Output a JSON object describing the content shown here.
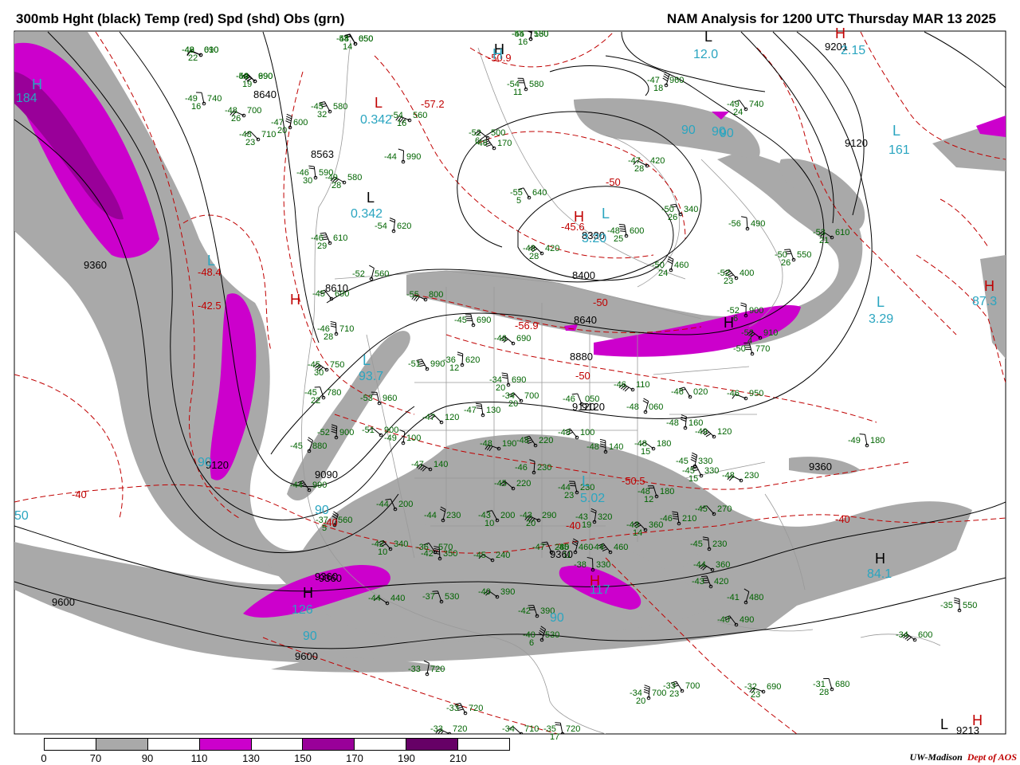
{
  "header": {
    "left_title": "300mb Hght (black) Temp (red) Spd (shd) Obs (grn)",
    "right_title": "NAM Analysis for 1200 UTC Thursday  MAR 13 2025"
  },
  "colors": {
    "height_contour": "#000000",
    "temp_contour": "#c00000",
    "shade_70_90": "#a9a9a9",
    "shade_110_130": "#cc00cc",
    "shade_150_170": "#990099",
    "shade_190_210": "#660066",
    "obs": "#006400",
    "speed_label": "#2aa5c0",
    "borders": "#999999"
  },
  "legend": {
    "ticks": [
      "0",
      "70",
      "90",
      "110",
      "130",
      "150",
      "170",
      "190",
      "210"
    ],
    "segment_colors": [
      "#ffffff",
      "#a9a9a9",
      "#ffffff",
      "#cc00cc",
      "#ffffff",
      "#990099",
      "#ffffff",
      "#660066",
      "#ffffff"
    ]
  },
  "credit": {
    "org": "UW-Madison",
    "dept": "Dept of AOS"
  },
  "height_labels": [
    "9360",
    "8640",
    "8563",
    "8610",
    "9120",
    "9600",
    "9360",
    "9600",
    "9120",
    "9090",
    "8400",
    "8330",
    "8640",
    "8880",
    "9120",
    "9360",
    "9360",
    "9360",
    "9120",
    "9201",
    "9213"
  ],
  "temp_labels": [
    "-48.4",
    "-42.5",
    "-57.2",
    "-50.9",
    "-45.6",
    "-50",
    "-56.9",
    "-50",
    "-50",
    "-50.5",
    "-40",
    "-40",
    "-40",
    "-40"
  ],
  "speed_labels": [
    "184",
    "0.342",
    "0.342",
    "93.7",
    "90",
    "90",
    "126",
    "90",
    "90",
    "12.0",
    "2.15",
    "161",
    "90",
    "3.29",
    "87.3",
    "84.1",
    "5.02",
    "90",
    "117",
    "90",
    "3.20",
    "50"
  ],
  "hl_markers": [
    "H",
    "L",
    "L",
    "L",
    "H",
    "H",
    "L",
    "H",
    "L",
    "L",
    "H",
    "H",
    "L",
    "H",
    "H",
    "L",
    "H",
    "H",
    "L",
    "H",
    "L",
    "H"
  ],
  "obs": [
    {
      "t": "-49",
      "d": "22",
      "h": "690"
    },
    {
      "t": "-54",
      "d": "14",
      "h": "650"
    },
    {
      "t": "-55",
      "d": "16",
      "h": "560"
    },
    {
      "t": "-50",
      "d": "19",
      "h": "690"
    },
    {
      "t": "-49",
      "d": "16",
      "h": "740"
    },
    {
      "t": "-48",
      "d": "26",
      "h": "700"
    },
    {
      "t": "-45",
      "d": "32",
      "h": "580"
    },
    {
      "t": "-47",
      "d": "20",
      "h": "600"
    },
    {
      "t": "-48",
      "d": "23",
      "h": "710"
    },
    {
      "t": "-46",
      "d": "30",
      "h": "590"
    },
    {
      "t": "-49",
      "d": "28",
      "h": "580"
    },
    {
      "t": "-46",
      "d": "29",
      "h": "610"
    },
    {
      "t": "-52",
      "d": "",
      "h": "560"
    },
    {
      "t": "-45",
      "d": "",
      "h": "690"
    },
    {
      "t": "-46",
      "d": "28",
      "h": "710"
    },
    {
      "t": "-45",
      "d": "30",
      "h": "750"
    },
    {
      "t": "-45",
      "d": "22",
      "h": "780"
    },
    {
      "t": "-45",
      "d": "",
      "h": "880"
    },
    {
      "t": "-44",
      "d": "",
      "h": "990"
    },
    {
      "t": "-52",
      "d": "",
      "h": "900"
    },
    {
      "t": "-51",
      "d": "",
      "h": "900"
    },
    {
      "t": "-53",
      "d": "",
      "h": "960"
    },
    {
      "t": "-55",
      "d": "",
      "h": "800"
    },
    {
      "t": "-51",
      "d": "",
      "h": "990"
    },
    {
      "t": "-49",
      "d": "",
      "h": "100"
    },
    {
      "t": "-47",
      "d": "",
      "h": "120"
    },
    {
      "t": "-47",
      "d": "",
      "h": "130"
    },
    {
      "t": "-47",
      "d": "",
      "h": "140"
    },
    {
      "t": "-44",
      "d": "",
      "h": "200"
    },
    {
      "t": "-44",
      "d": "",
      "h": "230"
    },
    {
      "t": "-42",
      "d": "10",
      "h": "340"
    },
    {
      "t": "-42",
      "d": "",
      "h": "350"
    },
    {
      "t": "-44",
      "d": "",
      "h": "440"
    },
    {
      "t": "-37",
      "d": "",
      "h": "530"
    },
    {
      "t": "-37",
      "d": "5",
      "h": "560"
    },
    {
      "t": "-46",
      "d": "",
      "h": "170"
    },
    {
      "t": "-44",
      "d": "",
      "h": "990"
    },
    {
      "t": "-52",
      "d": "6",
      "h": "500"
    },
    {
      "t": "-54",
      "d": "11",
      "h": "580"
    },
    {
      "t": "-54",
      "d": "16",
      "h": "560"
    },
    {
      "t": "-55",
      "d": "5",
      "h": "640"
    },
    {
      "t": "-54",
      "d": "",
      "h": "620"
    },
    {
      "t": "-48",
      "d": "28",
      "h": "420"
    },
    {
      "t": "-48",
      "d": "25",
      "h": "600"
    },
    {
      "t": "-47",
      "d": "28",
      "h": "420"
    },
    {
      "t": "-50",
      "d": "26",
      "h": "340"
    },
    {
      "t": "-50",
      "d": "24",
      "h": "460"
    },
    {
      "t": "-52",
      "d": "23",
      "h": "400"
    },
    {
      "t": "-56",
      "d": "",
      "h": "490"
    },
    {
      "t": "-53",
      "d": "21",
      "h": "610"
    },
    {
      "t": "-50",
      "d": "26",
      "h": "550"
    },
    {
      "t": "-47",
      "d": "18",
      "h": "960"
    },
    {
      "t": "-49",
      "d": "24",
      "h": "740"
    },
    {
      "t": "-52",
      "d": "6",
      "h": "900"
    },
    {
      "t": "-52",
      "d": "4",
      "h": "910"
    },
    {
      "t": "-50",
      "d": "",
      "h": "770"
    },
    {
      "t": "-46",
      "d": "",
      "h": "950"
    },
    {
      "t": "-46",
      "d": "",
      "h": "020"
    },
    {
      "t": "-48",
      "d": "",
      "h": "160"
    },
    {
      "t": "-49",
      "d": "",
      "h": "120"
    },
    {
      "t": "-49",
      "d": "",
      "h": "180"
    },
    {
      "t": "-48",
      "d": "",
      "h": "230"
    },
    {
      "t": "-45",
      "d": "15",
      "h": "330"
    },
    {
      "t": "-45",
      "d": "",
      "h": "330"
    },
    {
      "t": "-45",
      "d": "",
      "h": "270"
    },
    {
      "t": "-45",
      "d": "",
      "h": "230"
    },
    {
      "t": "-44",
      "d": "",
      "h": "360"
    },
    {
      "t": "-43",
      "d": "",
      "h": "420"
    },
    {
      "t": "-41",
      "d": "",
      "h": "480"
    },
    {
      "t": "-40",
      "d": "",
      "h": "490"
    },
    {
      "t": "-35",
      "d": "",
      "h": "550"
    },
    {
      "t": "-34",
      "d": "",
      "h": "600"
    },
    {
      "t": "-31",
      "d": "28",
      "h": "680"
    },
    {
      "t": "-32",
      "d": "23",
      "h": "690"
    },
    {
      "t": "-33",
      "d": "23",
      "h": "700"
    },
    {
      "t": "-34",
      "d": "20",
      "h": "700"
    },
    {
      "t": "-34",
      "d": "",
      "h": "710"
    },
    {
      "t": "-35",
      "d": "17",
      "h": "720"
    },
    {
      "t": "-33",
      "d": "",
      "h": "720"
    },
    {
      "t": "-33",
      "d": "",
      "h": "720"
    },
    {
      "t": "-33",
      "d": "",
      "h": "720"
    },
    {
      "t": "-34",
      "d": "20",
      "h": "700"
    },
    {
      "t": "-34",
      "d": "20",
      "h": "690"
    },
    {
      "t": "-46",
      "d": "",
      "h": "110"
    },
    {
      "t": "-46",
      "d": "",
      "h": "050"
    },
    {
      "t": "-48",
      "d": "",
      "h": "060"
    },
    {
      "t": "-48",
      "d": "",
      "h": "100"
    },
    {
      "t": "-48",
      "d": "",
      "h": "140"
    },
    {
      "t": "-48",
      "d": "15",
      "h": "180"
    },
    {
      "t": "-48",
      "d": "12",
      "h": "180"
    },
    {
      "t": "-48",
      "d": "",
      "h": "190"
    },
    {
      "t": "-48",
      "d": "",
      "h": "220"
    },
    {
      "t": "-46",
      "d": "",
      "h": "230"
    },
    {
      "t": "-45",
      "d": "",
      "h": "220"
    },
    {
      "t": "-44",
      "d": "23",
      "h": "230"
    },
    {
      "t": "-43",
      "d": "20",
      "h": "290"
    },
    {
      "t": "-43",
      "d": "10",
      "h": "200"
    },
    {
      "t": "-43",
      "d": "19",
      "h": "320"
    },
    {
      "t": "-43",
      "d": "14",
      "h": "360"
    },
    {
      "t": "-46",
      "d": "",
      "h": "210"
    },
    {
      "t": "-45",
      "d": "",
      "h": "240"
    },
    {
      "t": "-47",
      "d": "",
      "h": "280"
    },
    {
      "t": "-45",
      "d": "11",
      "h": "460"
    },
    {
      "t": "-44",
      "d": "",
      "h": "460"
    },
    {
      "t": "-38",
      "d": "",
      "h": "330"
    },
    {
      "t": "-40",
      "d": "",
      "h": "390"
    },
    {
      "t": "-42",
      "d": "",
      "h": "390"
    },
    {
      "t": "-40",
      "d": "6",
      "h": "530"
    },
    {
      "t": "-36",
      "d": "",
      "h": "570"
    },
    {
      "t": "-36",
      "d": "12",
      "h": "620"
    },
    {
      "t": "-46",
      "d": "",
      "h": "690"
    },
    {
      "t": "-45",
      "d": "",
      "h": "690"
    },
    {
      "t": "-48",
      "d": "",
      "h": "010"
    },
    {
      "t": "-48",
      "d": "",
      "h": "050"
    },
    {
      "t": "-44",
      "d": "",
      "h": "130"
    },
    {
      "t": "-44",
      "d": "",
      "h": "990"
    }
  ]
}
